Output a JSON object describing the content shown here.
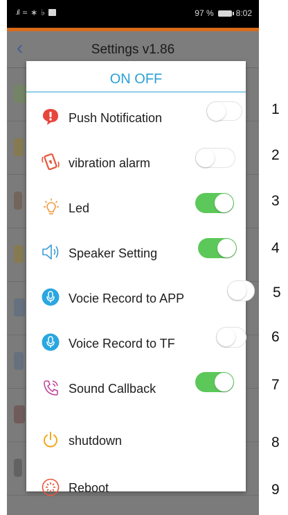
{
  "status_bar": {
    "battery": "97 %",
    "time": "8:02"
  },
  "header": {
    "title": "Settings v1.86"
  },
  "dialog": {
    "title": "ON OFF",
    "items": [
      {
        "label": "Push Notification",
        "icon": "exclamation-bubble-icon",
        "state": "off"
      },
      {
        "label": "vibration alarm",
        "icon": "vibrating-phone-icon",
        "state": "off"
      },
      {
        "label": "Led",
        "icon": "lightbulb-icon",
        "state": "on"
      },
      {
        "label": "Speaker Setting",
        "icon": "speaker-icon",
        "state": "on"
      },
      {
        "label": "Vocie Record to APP",
        "icon": "microphone-icon",
        "state": "off"
      },
      {
        "label": "Voice Record to TF",
        "icon": "microphone-icon",
        "state": "off"
      },
      {
        "label": "Sound Callback",
        "icon": "phone-callback-icon",
        "state": "on"
      },
      {
        "label": "shutdown",
        "icon": "power-icon",
        "state": null
      },
      {
        "label": "Reboot",
        "icon": "reboot-icon",
        "state": null
      }
    ]
  },
  "row_numbers": [
    "1",
    "2",
    "3",
    "4",
    "5",
    "6",
    "7",
    "8",
    "9"
  ],
  "colors": {
    "accent_orange": "#d96a18",
    "dialog_blue": "#2aa0d6",
    "toggle_on": "#5cc85a"
  }
}
